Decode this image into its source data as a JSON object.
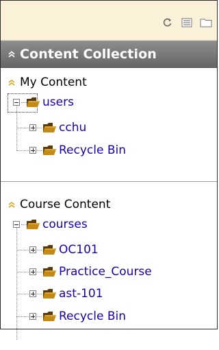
{
  "toolbar": {
    "icons": [
      "refresh-icon",
      "list-view-icon",
      "folder-view-icon"
    ]
  },
  "header": {
    "title": "Content Collection",
    "icon": "collapse-chevron-up-icon"
  },
  "sections": {
    "my_content": {
      "title": "My Content",
      "root": "users",
      "children": [
        "cchu",
        "Recycle Bin"
      ]
    },
    "course_content": {
      "title": "Course Content",
      "root": "courses",
      "children": [
        "OC101",
        "Practice_Course",
        "ast-101",
        "Recycle Bin"
      ]
    }
  },
  "colors": {
    "toolbar_bg": "#fbf1d9",
    "header_bg": "#777777",
    "link": "#1b00a8",
    "chevron": "#e0a21e"
  }
}
